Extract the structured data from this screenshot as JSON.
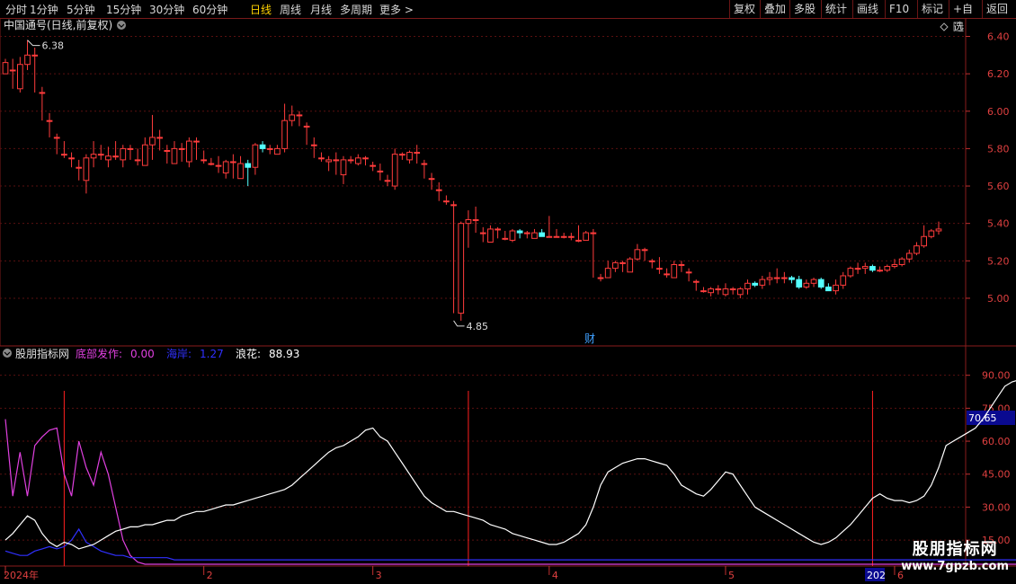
{
  "toolbar": {
    "periods": [
      "分时",
      "1分钟",
      "5分钟",
      "15分钟",
      "30分钟",
      "60分钟",
      "日线",
      "周线",
      "月线",
      "多周期",
      "更多 >"
    ],
    "active_index": 6,
    "right_buttons": [
      "复权",
      "叠加",
      "多股",
      "统计",
      "画线",
      "F10",
      "标记",
      "+自选",
      "返回"
    ]
  },
  "main_chart": {
    "title": "中国通号(日线,前复权)",
    "high_label": "6.38",
    "low_label": "4.85",
    "event_marker": "财"
  },
  "indicator": {
    "name": "股朋指标网",
    "items": [
      {
        "label": "底部发作:",
        "value": "0.00",
        "color": "#e040e0"
      },
      {
        "label": "海岸:",
        "value": "1.27",
        "color": "#3030ff"
      },
      {
        "label": "浪花:",
        "value": "88.93",
        "color": "#ffffff"
      }
    ],
    "current_value_label": "70.65"
  },
  "watermark": {
    "title": "股朋指标网",
    "url": "www.7gpzb.com"
  },
  "chart_data": [
    {
      "type": "candlestick",
      "title": "中国通号(日线,前复权)",
      "ylim": [
        4.75,
        6.46
      ],
      "y_ticks": [
        "6.40",
        "6.20",
        "6.00",
        "5.80",
        "5.60",
        "5.40",
        "5.20",
        "5.00"
      ],
      "colors": {
        "up": "#ff3c3c",
        "down": "#54ffff"
      },
      "ohlc": [
        [
          6.2,
          6.26,
          6.22,
          6.28
        ],
        [
          6.22,
          6.22,
          6.12,
          6.28
        ],
        [
          6.12,
          6.25,
          6.1,
          6.29
        ],
        [
          6.25,
          6.3,
          6.22,
          6.38
        ],
        [
          6.3,
          6.3,
          6.1,
          6.34
        ],
        [
          6.1,
          6.1,
          5.95,
          6.13
        ],
        [
          5.95,
          5.95,
          5.86,
          5.99
        ],
        [
          5.86,
          5.86,
          5.77,
          5.88
        ],
        [
          5.77,
          5.77,
          5.75,
          5.84
        ],
        [
          5.75,
          5.75,
          5.7,
          5.78
        ],
        [
          5.7,
          5.7,
          5.63,
          5.74
        ],
        [
          5.63,
          5.75,
          5.56,
          5.77
        ],
        [
          5.75,
          5.77,
          5.7,
          5.84
        ],
        [
          5.77,
          5.77,
          5.74,
          5.82
        ],
        [
          5.74,
          5.76,
          5.7,
          5.81
        ],
        [
          5.76,
          5.76,
          5.74,
          5.84
        ],
        [
          5.74,
          5.8,
          5.7,
          5.82
        ],
        [
          5.8,
          5.8,
          5.74,
          5.82
        ],
        [
          5.74,
          5.74,
          5.71,
          5.8
        ],
        [
          5.71,
          5.82,
          5.71,
          5.86
        ],
        [
          5.82,
          5.86,
          5.74,
          5.98
        ],
        [
          5.86,
          5.86,
          5.79,
          5.9
        ],
        [
          5.79,
          5.79,
          5.72,
          5.82
        ],
        [
          5.72,
          5.8,
          5.72,
          5.84
        ],
        [
          5.8,
          5.8,
          5.73,
          5.83
        ],
        [
          5.73,
          5.84,
          5.7,
          5.86
        ],
        [
          5.84,
          5.84,
          5.74,
          5.86
        ],
        [
          5.74,
          5.74,
          5.72,
          5.79
        ],
        [
          5.72,
          5.72,
          5.71,
          5.75
        ],
        [
          5.71,
          5.71,
          5.67,
          5.76
        ],
        [
          5.67,
          5.73,
          5.64,
          5.74
        ],
        [
          5.73,
          5.73,
          5.64,
          5.77
        ],
        [
          5.64,
          5.72,
          5.64,
          5.76
        ],
        [
          5.72,
          5.7,
          5.6,
          5.74
        ],
        [
          5.7,
          5.82,
          5.66,
          5.83
        ],
        [
          5.82,
          5.8,
          5.78,
          5.84
        ],
        [
          5.8,
          5.8,
          5.77,
          5.82
        ],
        [
          5.77,
          5.8,
          5.77,
          5.82
        ],
        [
          5.8,
          5.95,
          5.78,
          6.04
        ],
        [
          5.95,
          5.98,
          5.92,
          6.03
        ],
        [
          5.98,
          5.98,
          5.92,
          6.0
        ],
        [
          5.92,
          5.92,
          5.82,
          5.94
        ],
        [
          5.82,
          5.82,
          5.75,
          5.86
        ],
        [
          5.75,
          5.75,
          5.73,
          5.78
        ],
        [
          5.73,
          5.74,
          5.68,
          5.76
        ],
        [
          5.74,
          5.74,
          5.66,
          5.78
        ],
        [
          5.66,
          5.74,
          5.61,
          5.76
        ],
        [
          5.74,
          5.74,
          5.72,
          5.76
        ],
        [
          5.72,
          5.75,
          5.71,
          5.77
        ],
        [
          5.75,
          5.75,
          5.71,
          5.76
        ],
        [
          5.71,
          5.71,
          5.68,
          5.73
        ],
        [
          5.68,
          5.68,
          5.63,
          5.72
        ],
        [
          5.63,
          5.63,
          5.6,
          5.66
        ],
        [
          5.6,
          5.77,
          5.58,
          5.8
        ],
        [
          5.77,
          5.77,
          5.74,
          5.78
        ],
        [
          5.74,
          5.78,
          5.72,
          5.79
        ],
        [
          5.78,
          5.78,
          5.72,
          5.82
        ],
        [
          5.72,
          5.72,
          5.64,
          5.74
        ],
        [
          5.64,
          5.64,
          5.58,
          5.67
        ],
        [
          5.58,
          5.58,
          5.52,
          5.62
        ],
        [
          5.52,
          5.52,
          5.5,
          5.55
        ],
        [
          5.5,
          5.5,
          4.92,
          5.52
        ],
        [
          4.92,
          5.4,
          4.88,
          5.41
        ],
        [
          5.4,
          5.42,
          5.27,
          5.47
        ],
        [
          5.42,
          5.42,
          5.35,
          5.49
        ],
        [
          5.35,
          5.35,
          5.3,
          5.38
        ],
        [
          5.3,
          5.37,
          5.3,
          5.39
        ],
        [
          5.37,
          5.37,
          5.32,
          5.38
        ],
        [
          5.32,
          5.32,
          5.31,
          5.36
        ],
        [
          5.31,
          5.36,
          5.3,
          5.37
        ],
        [
          5.36,
          5.35,
          5.32,
          5.37
        ],
        [
          5.35,
          5.35,
          5.32,
          5.36
        ],
        [
          5.32,
          5.35,
          5.32,
          5.37
        ],
        [
          5.35,
          5.33,
          5.33,
          5.37
        ],
        [
          5.33,
          5.33,
          5.33,
          5.44
        ],
        [
          5.33,
          5.33,
          5.33,
          5.37
        ],
        [
          5.33,
          5.33,
          5.32,
          5.35
        ],
        [
          5.33,
          5.33,
          5.31,
          5.35
        ],
        [
          5.31,
          5.31,
          5.3,
          5.39
        ],
        [
          5.31,
          5.35,
          5.31,
          5.36
        ],
        [
          5.35,
          5.35,
          5.11,
          5.37
        ],
        [
          5.11,
          5.11,
          5.09,
          5.13
        ],
        [
          5.11,
          5.16,
          5.11,
          5.2
        ],
        [
          5.16,
          5.19,
          5.14,
          5.2
        ],
        [
          5.19,
          5.19,
          5.14,
          5.2
        ],
        [
          5.14,
          5.21,
          5.14,
          5.22
        ],
        [
          5.21,
          5.26,
          5.2,
          5.29
        ],
        [
          5.26,
          5.26,
          5.2,
          5.27
        ],
        [
          5.2,
          5.2,
          5.16,
          5.21
        ],
        [
          5.16,
          5.16,
          5.13,
          5.22
        ],
        [
          5.13,
          5.13,
          5.11,
          5.16
        ],
        [
          5.11,
          5.18,
          5.11,
          5.2
        ],
        [
          5.18,
          5.18,
          5.14,
          5.2
        ],
        [
          5.14,
          5.14,
          5.09,
          5.16
        ],
        [
          5.09,
          5.09,
          5.04,
          5.1
        ],
        [
          5.04,
          5.04,
          5.03,
          5.06
        ],
        [
          5.03,
          5.05,
          5.01,
          5.06
        ],
        [
          5.05,
          5.05,
          5.02,
          5.07
        ],
        [
          5.02,
          5.05,
          5.01,
          5.08
        ],
        [
          5.05,
          5.05,
          5.02,
          5.06
        ],
        [
          5.02,
          5.05,
          5.0,
          5.06
        ],
        [
          5.05,
          5.08,
          5.02,
          5.1
        ],
        [
          5.08,
          5.07,
          5.06,
          5.09
        ],
        [
          5.07,
          5.1,
          5.05,
          5.12
        ],
        [
          5.1,
          5.11,
          5.07,
          5.14
        ],
        [
          5.11,
          5.11,
          5.08,
          5.16
        ],
        [
          5.11,
          5.11,
          5.08,
          5.14
        ],
        [
          5.11,
          5.1,
          5.08,
          5.12
        ],
        [
          5.1,
          5.06,
          5.05,
          5.12
        ],
        [
          5.06,
          5.08,
          5.05,
          5.1
        ],
        [
          5.08,
          5.1,
          5.06,
          5.11
        ],
        [
          5.1,
          5.06,
          5.05,
          5.11
        ],
        [
          5.06,
          5.04,
          5.04,
          5.08
        ],
        [
          5.04,
          5.07,
          5.02,
          5.1
        ],
        [
          5.07,
          5.12,
          5.05,
          5.14
        ],
        [
          5.12,
          5.16,
          5.11,
          5.17
        ],
        [
          5.16,
          5.16,
          5.13,
          5.19
        ],
        [
          5.16,
          5.17,
          5.13,
          5.19
        ],
        [
          5.17,
          5.15,
          5.14,
          5.18
        ],
        [
          5.15,
          5.15,
          5.14,
          5.17
        ],
        [
          5.15,
          5.17,
          5.14,
          5.18
        ],
        [
          5.17,
          5.18,
          5.16,
          5.21
        ],
        [
          5.18,
          5.21,
          5.17,
          5.22
        ],
        [
          5.21,
          5.24,
          5.19,
          5.26
        ],
        [
          5.24,
          5.28,
          5.23,
          5.3
        ],
        [
          5.28,
          5.33,
          5.27,
          5.39
        ],
        [
          5.33,
          5.36,
          5.32,
          5.37
        ],
        [
          5.36,
          5.37,
          5.34,
          5.41
        ]
      ],
      "annotations": [
        {
          "text": "6.38"
        },
        {
          "text": "4.85"
        },
        {
          "text": "财"
        }
      ]
    },
    {
      "type": "line",
      "title": "股朋指标网",
      "ylim": [
        4,
        96
      ],
      "y_ticks": [
        "90.00",
        "75.00",
        "60.00",
        "45.00",
        "30.00",
        "15.00"
      ],
      "x_ticks": [
        "2024年",
        "2",
        "3",
        "4",
        "5",
        "6",
        "202"
      ],
      "series": [
        {
          "name": "底部发作",
          "color": "#e040e0",
          "values": [
            70,
            35,
            55,
            35,
            58,
            62,
            65,
            66,
            45,
            35,
            60,
            48,
            40,
            55,
            45,
            30,
            15,
            8,
            5,
            4,
            4,
            4,
            4,
            4,
            4,
            4,
            4,
            4,
            4,
            4,
            4,
            4,
            4,
            4,
            4,
            4,
            4,
            4,
            4,
            4,
            4,
            4,
            4,
            4,
            4,
            4,
            4,
            4,
            4,
            4,
            4,
            4,
            4,
            4,
            4,
            4,
            4,
            4,
            4,
            4,
            4,
            4,
            4,
            4,
            4,
            4,
            4,
            4,
            4,
            4,
            4,
            4,
            4,
            4,
            4,
            4,
            4,
            4,
            4,
            4,
            4,
            4,
            4,
            4,
            4,
            4,
            4,
            4,
            4,
            4,
            4,
            4,
            4,
            4,
            4,
            4,
            4,
            4,
            4,
            4,
            4,
            4,
            4,
            4,
            4,
            4,
            4,
            4,
            4,
            4,
            4,
            4,
            4,
            4,
            4,
            4,
            4,
            4,
            4,
            4,
            4,
            4,
            4,
            4,
            4,
            4,
            4,
            4,
            4,
            4,
            4,
            4,
            4,
            4,
            4,
            4,
            4,
            4,
            4,
            4
          ]
        },
        {
          "name": "海岸",
          "color": "#3030ff",
          "values": [
            10,
            9,
            8,
            8,
            10,
            11,
            12,
            11,
            12,
            15,
            20,
            14,
            12,
            10,
            9,
            8,
            8,
            7,
            7,
            7,
            7,
            7,
            7,
            6,
            6,
            6,
            6,
            6,
            6,
            6,
            6,
            6,
            6,
            6,
            6,
            6,
            6,
            6,
            6,
            6,
            6,
            6,
            6,
            6,
            6,
            6,
            6,
            6,
            6,
            6,
            6,
            6,
            6,
            6,
            6,
            6,
            6,
            6,
            6,
            6,
            6,
            6,
            6,
            6,
            6,
            6,
            6,
            6,
            6,
            6,
            6,
            6,
            6,
            6,
            6,
            6,
            6,
            6,
            6,
            6,
            6,
            6,
            6,
            6,
            6,
            6,
            6,
            6,
            6,
            6,
            6,
            6,
            6,
            6,
            6,
            6,
            6,
            6,
            6,
            6,
            6,
            6,
            6,
            6,
            6,
            6,
            6,
            6,
            6,
            6,
            6,
            6,
            6,
            6,
            6,
            6,
            6,
            6,
            6,
            6,
            6,
            6,
            6,
            6,
            6,
            6,
            6,
            6,
            6,
            6,
            6,
            6,
            6,
            6,
            6,
            6,
            6,
            6,
            6,
            6
          ]
        },
        {
          "name": "浪花",
          "color": "#ffffff",
          "values": [
            15,
            18,
            22,
            26,
            24,
            18,
            14,
            12,
            14,
            13,
            11,
            12,
            13,
            15,
            17,
            19,
            20,
            21,
            21,
            22,
            22,
            23,
            24,
            24,
            26,
            27,
            28,
            28,
            29,
            30,
            31,
            31,
            32,
            33,
            34,
            35,
            36,
            37,
            38,
            40,
            43,
            46,
            49,
            52,
            55,
            57,
            58,
            60,
            62,
            65,
            66,
            62,
            60,
            55,
            50,
            45,
            40,
            35,
            32,
            30,
            28,
            28,
            27,
            26,
            25,
            24,
            22,
            21,
            20,
            18,
            17,
            16,
            15,
            14,
            13,
            13,
            14,
            16,
            18,
            22,
            30,
            40,
            46,
            48,
            50,
            51,
            52,
            52,
            51,
            50,
            49,
            45,
            40,
            38,
            36,
            35,
            38,
            42,
            46,
            45,
            40,
            35,
            30,
            28,
            26,
            24,
            22,
            20,
            18,
            16,
            14,
            13,
            14,
            16,
            19,
            22,
            26,
            30,
            34,
            36,
            34,
            33,
            33,
            32,
            33,
            35,
            40,
            48,
            58,
            60,
            62,
            64,
            66,
            70,
            75,
            80,
            85,
            87,
            88,
            88.93
          ]
        }
      ],
      "vertical_markers_at_index": [
        8,
        63,
        118
      ]
    }
  ]
}
